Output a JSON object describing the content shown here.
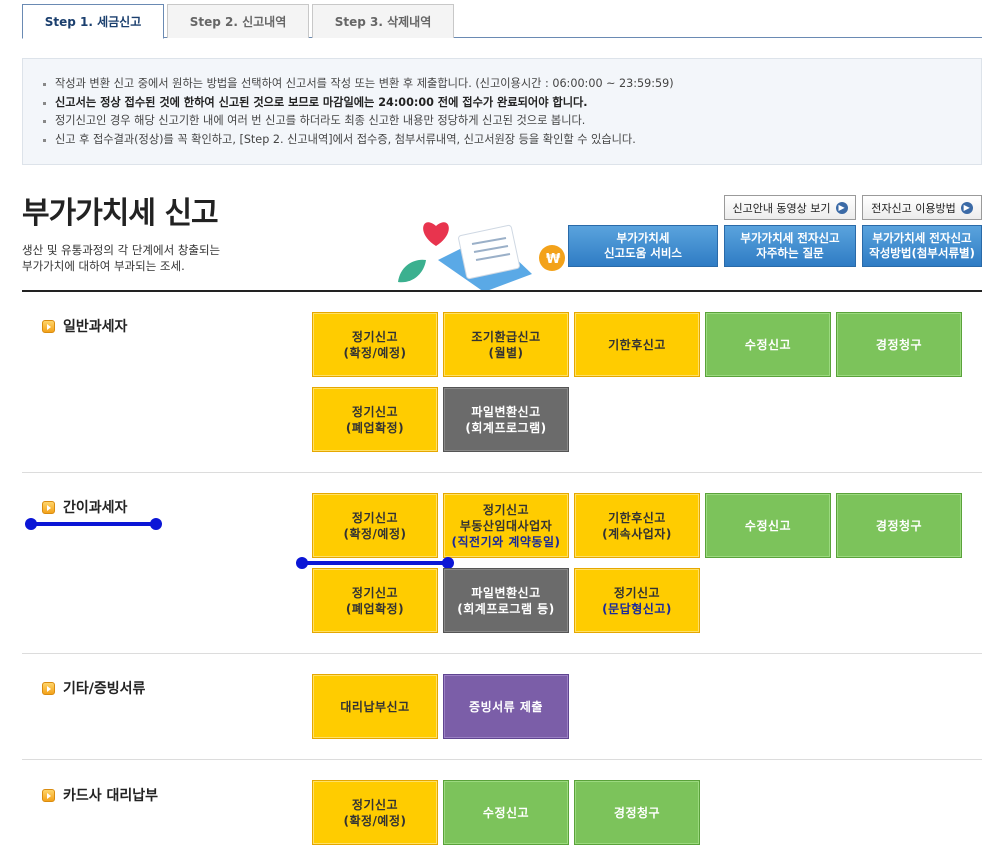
{
  "tabs": [
    {
      "label": "Step 1. 세금신고",
      "active": true
    },
    {
      "label": "Step 2. 신고내역",
      "active": false
    },
    {
      "label": "Step 3. 삭제내역",
      "active": false
    }
  ],
  "notice": [
    "작성과 변환 신고 중에서 원하는 방법을 선택하여 신고서를 작성 또는 변환 후 제출합니다. (신고이용시간 : 06:00:00 ~ 23:59:59)",
    "신고서는 정상 접수된 것에 한하여 신고된 것으로 보므로 마감일에는 24:00:00 전에 접수가 완료되어야 합니다.",
    "정기신고인 경우 해당 신고기한 내에 여러 번 신고를 하더라도 최종 신고한 내용만 정당하게 신고된 것으로 봅니다.",
    "신고 후 접수결과(정상)를 꼭 확인하고, [Step 2. 신고내역]에서 접수증, 첨부서류내역, 신고서원장 등을 확인할 수 있습니다."
  ],
  "header": {
    "title": "부가가치세 신고",
    "desc_line1": "생산 및 유통과정의 각 단계에서 창출되는",
    "desc_line2": "부가가치에 대하여 부과되는 조세."
  },
  "top_links": {
    "video": "신고안내 동영상 보기",
    "e_filing": "전자신고 이용방법"
  },
  "help_buttons": [
    {
      "line1": "부가가치세",
      "line2": "신고도움 서비스"
    },
    {
      "line1": "부가가치세 전자신고",
      "line2": "자주하는 질문"
    },
    {
      "line1": "부가가치세 전자신고",
      "line2": "작성방법(첨부서류별)"
    }
  ],
  "sections": {
    "general": {
      "label": "일반과세자",
      "buttons": [
        {
          "l1": "정기신고",
          "l2": "(확정/예정)"
        },
        {
          "l1": "조기환급신고",
          "l2": "(월별)"
        },
        {
          "l1": "기한후신고"
        },
        {
          "l1": "수정신고"
        },
        {
          "l1": "경정청구"
        },
        {
          "l1": "정기신고",
          "l2": "(폐업확정)"
        },
        {
          "l1": "파일변환신고",
          "l2": "(회계프로그램)"
        }
      ]
    },
    "simple": {
      "label": "간이과세자",
      "buttons": [
        {
          "l1": "정기신고",
          "l2": "(확정/예정)"
        },
        {
          "l1": "정기신고",
          "l2": "부동산임대사업자",
          "l3": "(직전기와 계약동일)"
        },
        {
          "l1": "기한후신고",
          "l2": "(계속사업자)"
        },
        {
          "l1": "수정신고"
        },
        {
          "l1": "경정청구"
        },
        {
          "l1": "정기신고",
          "l2": "(폐업확정)"
        },
        {
          "l1": "파일변환신고",
          "l2": "(회계프로그램 등)"
        },
        {
          "l1": "정기신고",
          "l2": "(문답형신고)"
        }
      ]
    },
    "etc": {
      "label": "기타/증빙서류",
      "buttons": [
        {
          "l1": "대리납부신고"
        },
        {
          "l1": "증빙서류 제출"
        }
      ]
    },
    "card": {
      "label": "카드사 대리납부",
      "buttons": [
        {
          "l1": "정기신고",
          "l2": "(확정/예정)"
        },
        {
          "l1": "수정신고"
        },
        {
          "l1": "경정청구"
        }
      ]
    }
  },
  "colors": {
    "yellow": "#ffcc00",
    "green": "#7cc35b",
    "gray": "#6b6b6b",
    "purple": "#7b5ea8",
    "help_blue": "#2f7cc4",
    "annotation": "#0b16d6"
  }
}
